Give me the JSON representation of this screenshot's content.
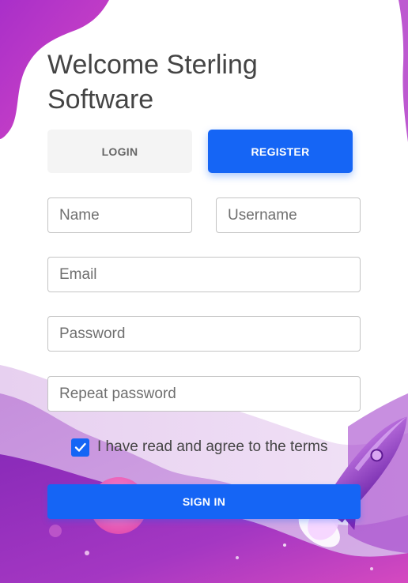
{
  "header": {
    "title": "Welcome Sterling Software"
  },
  "tabs": {
    "login": "LOGIN",
    "register": "REGISTER"
  },
  "form": {
    "name_placeholder": "Name",
    "username_placeholder": "Username",
    "email_placeholder": "Email",
    "password_placeholder": "Password",
    "repeat_password_placeholder": "Repeat password",
    "terms_label": "I have read and agree to the terms",
    "terms_checked": true,
    "submit_label": "SIGN IN"
  },
  "colors": {
    "accent": "#1565f5",
    "background_purple": "#9b2fc0",
    "background_magenta": "#c23cc7",
    "background_light": "#e3c9ef"
  },
  "icons": {
    "checkbox": "check-icon",
    "illustration": "rocket-icon"
  }
}
